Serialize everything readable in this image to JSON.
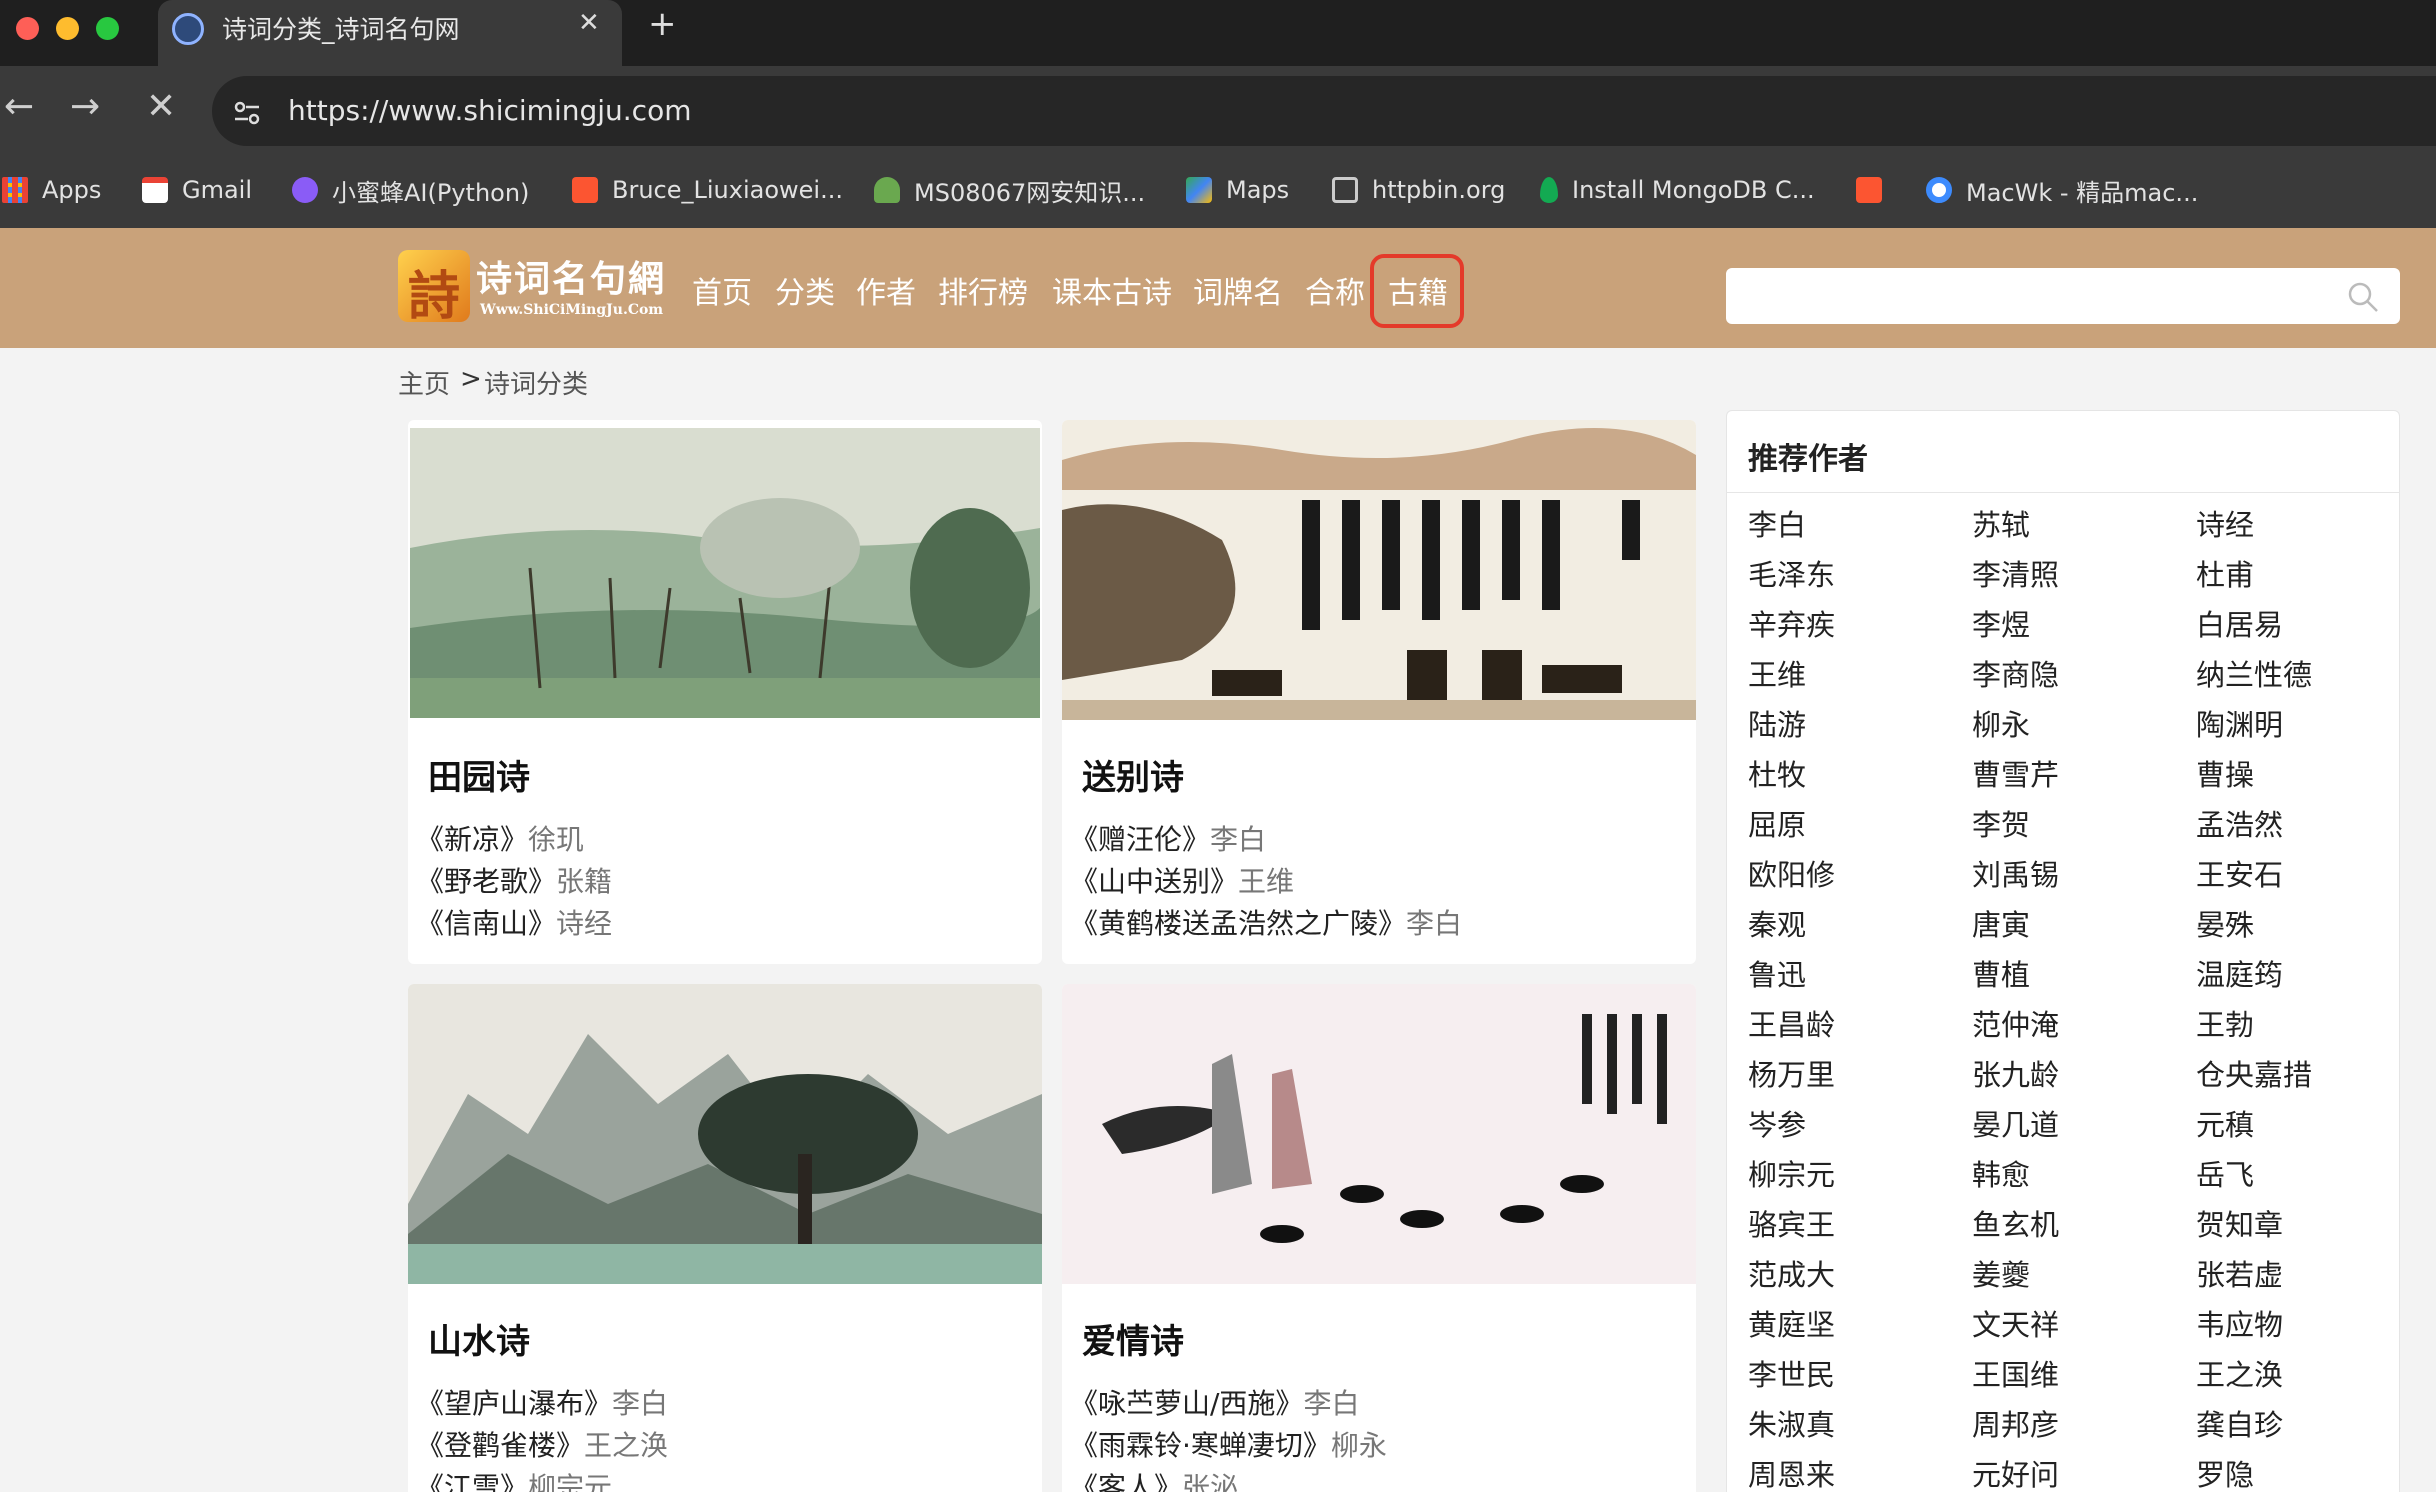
{
  "browser": {
    "tab_title": "诗词分类_诗词名句网",
    "url": "https://www.shicimingju.com",
    "bookmarks": [
      "Apps",
      "Gmail",
      "小蜜蜂AI(Python)",
      "Bruce_Liuxiaowei...",
      "MS08067网安知识...",
      "Maps",
      "httpbin.org",
      "Install MongoDB C...",
      "",
      "MacWk - 精品mac..."
    ]
  },
  "site": {
    "logo_text": "诗词名句網",
    "logo_sub": "Www.ShiCiMingJu.Com",
    "nav": [
      "首页",
      "分类",
      "作者",
      "排行榜",
      "课本古诗",
      "词牌名",
      "合称",
      "古籍"
    ],
    "search_placeholder": ""
  },
  "breadcrumb": {
    "home": "主页",
    "sep": ">",
    "current": "诗词分类"
  },
  "categories": [
    {
      "title": "田园诗",
      "poems": [
        {
          "t": "《新凉》",
          "a": "徐玑"
        },
        {
          "t": "《野老歌》",
          "a": "张籍"
        },
        {
          "t": "《信南山》",
          "a": "诗经"
        }
      ]
    },
    {
      "title": "送别诗",
      "poems": [
        {
          "t": "《赠汪伦》",
          "a": "李白"
        },
        {
          "t": "《山中送别》",
          "a": "王维"
        },
        {
          "t": "《黄鹤楼送孟浩然之广陵》",
          "a": "李白"
        }
      ]
    },
    {
      "title": "山水诗",
      "poems": [
        {
          "t": "《望庐山瀑布》",
          "a": "李白"
        },
        {
          "t": "《登鹳雀楼》",
          "a": "王之涣"
        },
        {
          "t": "《江雪》",
          "a": "柳宗元"
        }
      ]
    },
    {
      "title": "爱情诗",
      "poems": [
        {
          "t": "《咏苎萝山/西施》",
          "a": "李白"
        },
        {
          "t": "《雨霖铃·寒蝉凄切》",
          "a": "柳永"
        },
        {
          "t": "《客人》",
          "a": "张泌"
        }
      ]
    }
  ],
  "sidebar": {
    "title": "推荐作者",
    "authors": [
      [
        "李白",
        "苏轼",
        "诗经"
      ],
      [
        "毛泽东",
        "李清照",
        "杜甫"
      ],
      [
        "辛弃疾",
        "李煜",
        "白居易"
      ],
      [
        "王维",
        "李商隐",
        "纳兰性德"
      ],
      [
        "陆游",
        "柳永",
        "陶渊明"
      ],
      [
        "杜牧",
        "曹雪芹",
        "曹操"
      ],
      [
        "屈原",
        "李贺",
        "孟浩然"
      ],
      [
        "欧阳修",
        "刘禹锡",
        "王安石"
      ],
      [
        "秦观",
        "唐寅",
        "晏殊"
      ],
      [
        "鲁迅",
        "曹植",
        "温庭筠"
      ],
      [
        "王昌龄",
        "范仲淹",
        "王勃"
      ],
      [
        "杨万里",
        "张九龄",
        "仓央嘉措"
      ],
      [
        "岑参",
        "晏几道",
        "元稹"
      ],
      [
        "柳宗元",
        "韩愈",
        "岳飞"
      ],
      [
        "骆宾王",
        "鱼玄机",
        "贺知章"
      ],
      [
        "范成大",
        "姜夔",
        "张若虚"
      ],
      [
        "黄庭坚",
        "文天祥",
        "韦应物"
      ],
      [
        "李世民",
        "王国维",
        "王之涣"
      ],
      [
        "朱淑真",
        "周邦彦",
        "龚自珍"
      ],
      [
        "周恩来",
        "元好问",
        "罗隐"
      ]
    ]
  },
  "colors": {
    "header_bg": "#c9a27a",
    "highlight": "#e43a2a"
  }
}
